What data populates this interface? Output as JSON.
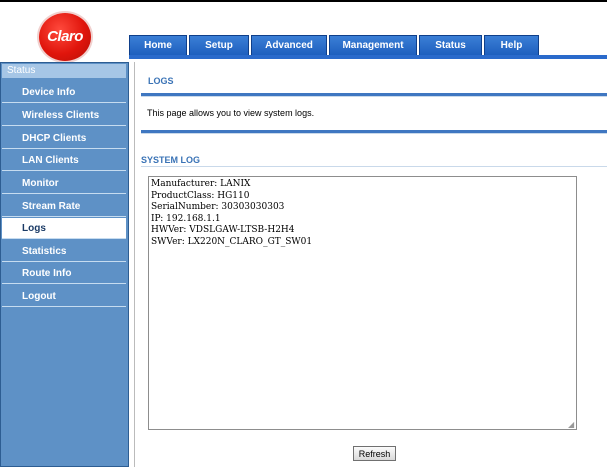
{
  "brand": {
    "logo_text": "Claro"
  },
  "tabs": [
    {
      "label": "Home"
    },
    {
      "label": "Setup"
    },
    {
      "label": "Advanced"
    },
    {
      "label": "Management"
    },
    {
      "label": "Status"
    },
    {
      "label": "Help"
    }
  ],
  "sidebar": {
    "header": "Status",
    "items": [
      {
        "label": "Device Info"
      },
      {
        "label": "Wireless Clients"
      },
      {
        "label": "DHCP Clients"
      },
      {
        "label": "LAN Clients"
      },
      {
        "label": "Monitor"
      },
      {
        "label": "Stream Rate"
      },
      {
        "label": "Logs",
        "active": true
      },
      {
        "label": "Statistics"
      },
      {
        "label": "Route Info"
      },
      {
        "label": "Logout"
      }
    ]
  },
  "main": {
    "title": "LOGS",
    "description": "This page allows you to view system logs.",
    "section_title": "SYSTEM LOG",
    "log_text": "Manufacturer: LANIX\nProductClass: HG110\nSerialNumber: 30303030303\nIP: 192.168.1.1\nHWVer: VDSLGAW-LTSB-H2H4\nSWVer: LX220N_CLARO_GT_SW01",
    "refresh_label": "Refresh"
  }
}
